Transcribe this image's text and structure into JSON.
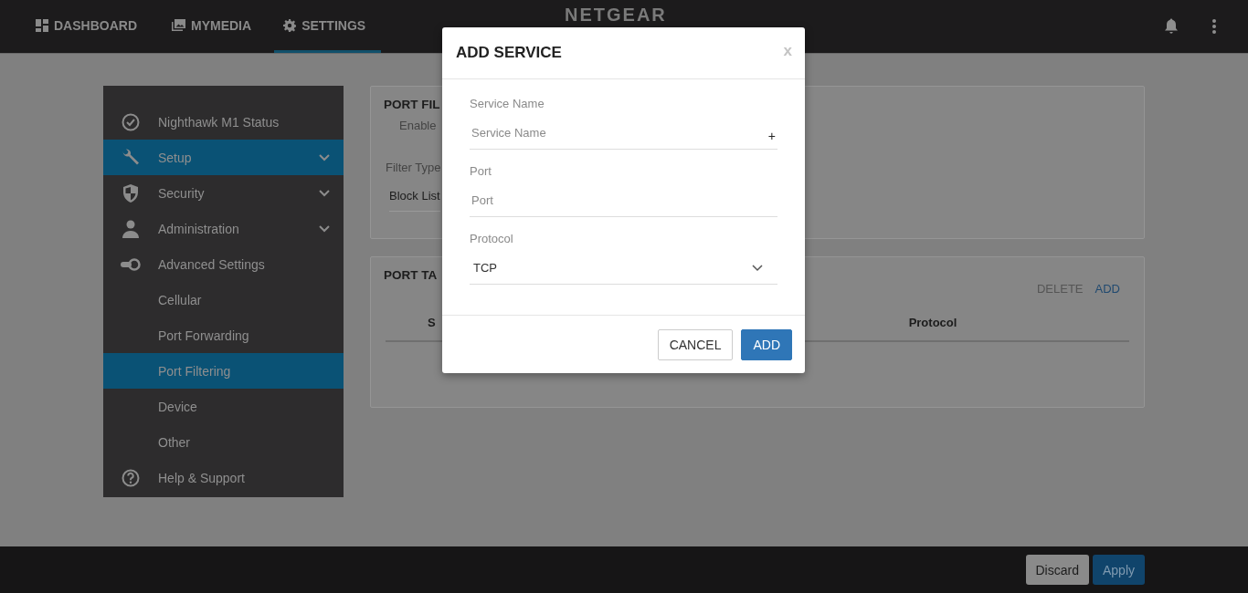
{
  "nav": {
    "tabs": [
      {
        "label": "DASHBOARD",
        "selected": false
      },
      {
        "label": "MYMEDIA",
        "selected": false
      },
      {
        "label": "SETTINGS",
        "selected": true
      }
    ],
    "logo": "NETGEAR"
  },
  "sidebar": {
    "items": [
      {
        "label": "Nighthawk M1 Status",
        "submenu": false,
        "selected": false
      },
      {
        "label": "Setup",
        "submenu": true,
        "selected": true
      },
      {
        "label": "Security",
        "submenu": true,
        "selected": false
      },
      {
        "label": "Administration",
        "submenu": true,
        "selected": false
      },
      {
        "label": "Advanced Settings",
        "submenu": false,
        "selected": false
      },
      {
        "label": "Cellular",
        "submenu": false,
        "selected": false
      },
      {
        "label": "Port Forwarding",
        "submenu": false,
        "selected": false
      },
      {
        "label": "Port Filtering",
        "submenu": false,
        "selected": true
      },
      {
        "label": "Device",
        "submenu": false,
        "selected": false
      },
      {
        "label": "Other",
        "submenu": false,
        "selected": false
      },
      {
        "label": "Help & Support",
        "submenu": false,
        "selected": false
      }
    ]
  },
  "port_filtering": {
    "title": "PORT FIL",
    "enable_label": "Enable",
    "filter_type_label": "Filter Type",
    "filter_type_value": "Block List"
  },
  "port_table": {
    "title": "PORT TA",
    "actions": [
      "DELETE",
      "ADD"
    ],
    "columns": [
      "S",
      "Protocol"
    ]
  },
  "dialog": {
    "title": "ADD SERVICE",
    "close": "x",
    "fields": [
      {
        "kind": "text",
        "label": "Service Name",
        "placeholder": "Service Name",
        "suffix": "+"
      },
      {
        "kind": "text",
        "label": "Port",
        "placeholder": "Port"
      },
      {
        "kind": "select",
        "label": "Protocol",
        "value": "TCP"
      }
    ],
    "buttons": [
      {
        "label": "CANCEL",
        "kind": "secondary"
      },
      {
        "label": "ADD",
        "kind": "primary"
      }
    ]
  },
  "footer": {
    "buttons": [
      {
        "label": "Discard",
        "kind": "secondary"
      },
      {
        "label": "Apply",
        "kind": "primary"
      }
    ]
  }
}
